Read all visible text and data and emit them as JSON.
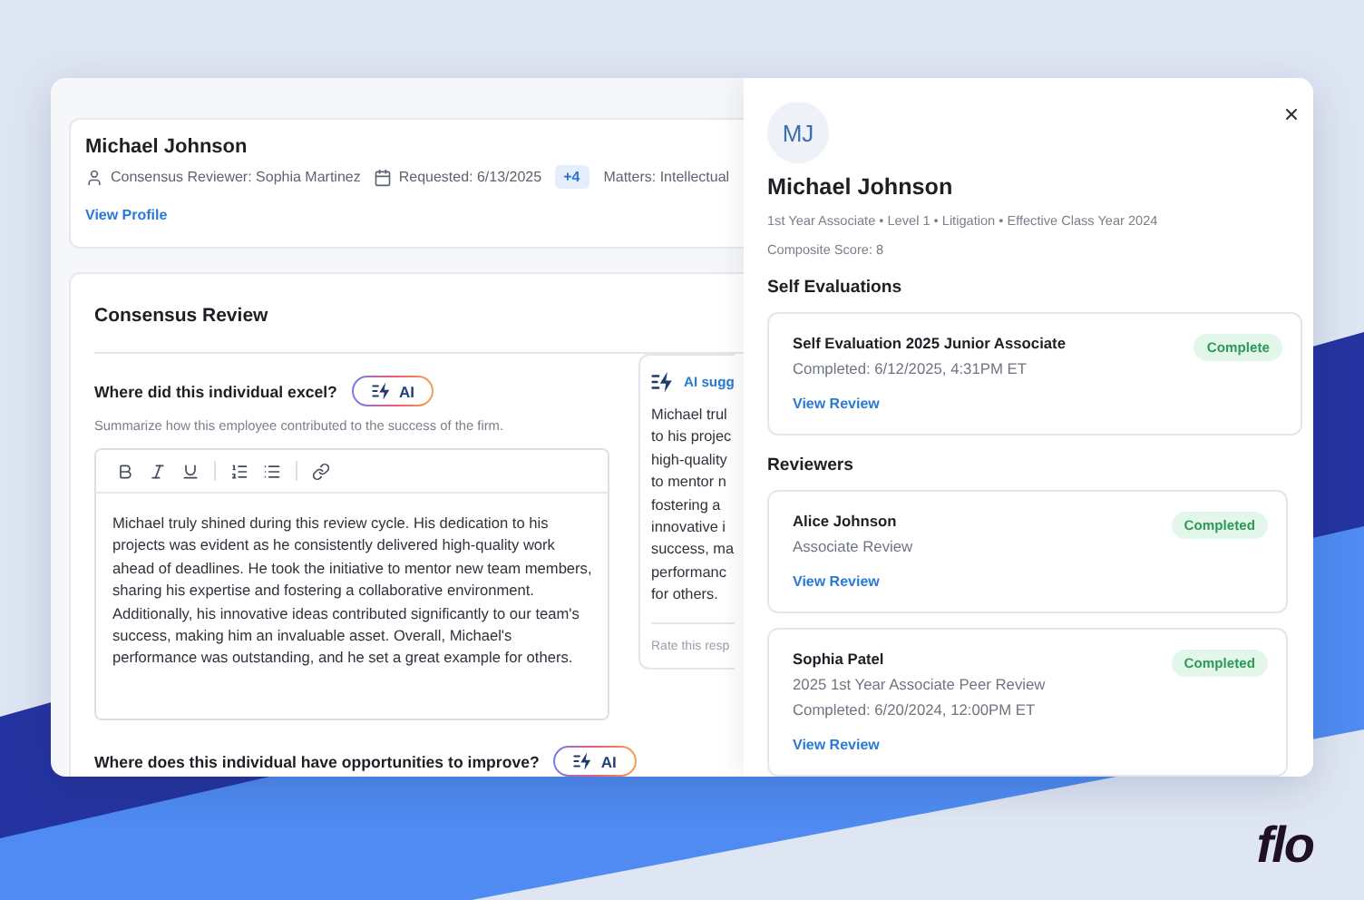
{
  "profile_header": {
    "name": "Michael Johnson",
    "reviewer": "Consensus Reviewer: Sophia Martinez",
    "requested": "Requested: 6/13/2025",
    "extra_count": "+4",
    "matters": "Matters: Intellectual",
    "link": "View Profile"
  },
  "review": {
    "title": "Consensus Review",
    "questions": [
      {
        "question": "Where did this individual excel?",
        "ai_button": "AI",
        "hint": "Summarize how this employee contributed to the success of the firm.",
        "value": "Michael truly shined during this review cycle. His dedication to his projects was evident as he consistently delivered high-quality work ahead of deadlines. He took the initiative to mentor new team members, sharing his expertise and fostering a collaborative environment. Additionally, his innovative ideas contributed significantly to our team's success, making him an invaluable asset. Overall, Michael's performance was outstanding, and he set a great example for others."
      },
      {
        "question": "Where does this individual have opportunities to improve?",
        "ai_button": "AI"
      }
    ],
    "suggestion": {
      "title": "AI sugg",
      "lines": [
        "Michael trul",
        "to his projec",
        "high-quality",
        "to mentor n",
        "fostering a",
        "innovative i",
        "success, ma",
        "performanc",
        "for others."
      ],
      "footer": "Rate this resp"
    }
  },
  "drawer": {
    "initials": "MJ",
    "name": "Michael Johnson",
    "meta": "1st Year Associate • Level 1 • Litigation • Effective Class Year 2024",
    "score": "Composite Score: 8",
    "sections": [
      {
        "title": "Self Evaluations",
        "cards": [
          {
            "title": "Self Evaluation 2025 Junior Associate",
            "lines": [
              "Completed: 6/12/2025, 4:31PM ET"
            ],
            "link": "View Review",
            "status": "Complete"
          }
        ]
      },
      {
        "title": "Reviewers",
        "cards": [
          {
            "title": "Alice Johnson",
            "lines": [
              "Associate Review"
            ],
            "link": "View Review",
            "status": "Completed"
          },
          {
            "title": "Sophia Patel",
            "lines": [
              "2025 1st Year Associate Peer Review",
              "Completed: 6/20/2024, 12:00PM ET"
            ],
            "link": "View Review",
            "status": "Completed"
          }
        ]
      }
    ]
  },
  "brand": "flo"
}
